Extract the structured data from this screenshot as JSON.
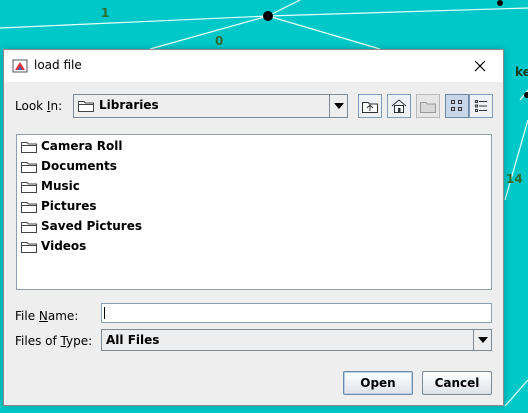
{
  "background": {
    "labels": [
      "1",
      "0",
      "ke",
      "14"
    ],
    "color": "#00c8c8"
  },
  "dialog": {
    "title": "load file",
    "look_in": {
      "label_pre": "Look ",
      "label_mnemonic": "I",
      "label_post": "n:",
      "value": "Libraries"
    },
    "toolbar": {
      "up_icon": "up-folder-icon",
      "home_icon": "home-icon",
      "new_folder_icon": "new-folder-icon",
      "list_icon": "list-view-icon",
      "details_icon": "details-view-icon"
    },
    "files": [
      "Camera Roll",
      "Documents",
      "Music",
      "Pictures",
      "Saved Pictures",
      "Videos"
    ],
    "file_name": {
      "label_pre": "File ",
      "label_mnemonic": "N",
      "label_post": "ame:",
      "value": ""
    },
    "files_of_type": {
      "label_pre": "Files of ",
      "label_mnemonic": "T",
      "label_post": "ype:",
      "value": "All Files"
    },
    "buttons": {
      "open": "Open",
      "cancel": "Cancel"
    }
  }
}
